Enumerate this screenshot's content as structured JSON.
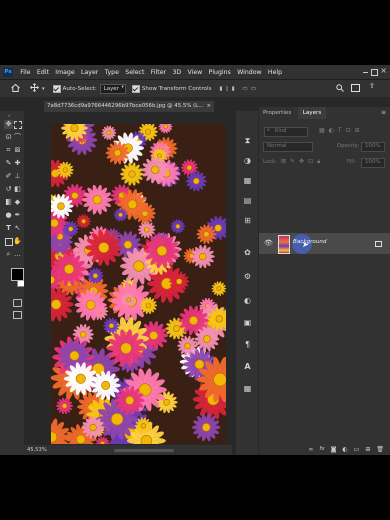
{
  "app": {
    "logo": "Ps"
  },
  "menu": [
    "File",
    "Edit",
    "Image",
    "Layer",
    "Type",
    "Select",
    "Filter",
    "3D",
    "View",
    "Plugins",
    "Window",
    "Help"
  ],
  "options": {
    "auto_select_label": "Auto-Select:",
    "auto_select_value": "Layer",
    "transform_label": "Show Transform Controls"
  },
  "document": {
    "tab_title": "7a8d7736cd9a9766446296b97bce056b.jpg @ 45.5% (L...",
    "zoom_status": "45.53%"
  },
  "panel": {
    "tabs": [
      "Properties",
      "Layers"
    ],
    "search_placeholder": "Kind",
    "blend_mode": "Normal",
    "opacity_label": "Opacity:",
    "opacity_value": "100%",
    "lock_label": "Lock:",
    "fill_label": "Fill:",
    "fill_value": "100%",
    "layer_name": "Background"
  },
  "colors": {
    "ui_bg": "#282828",
    "panel_bg": "#323232",
    "accent": "#31a8ff",
    "foreground_swatch": "#000000",
    "background_swatch": "#ffffff"
  },
  "icons": {
    "toolbar": [
      "move-icon",
      "marquee-icon",
      "lasso-icon",
      "quick-select-icon",
      "crop-icon",
      "frame-icon",
      "eyedropper-icon",
      "healing-icon",
      "brush-icon",
      "stamp-icon",
      "history-brush-icon",
      "eraser-icon",
      "gradient-icon",
      "blur-icon",
      "dodge-icon",
      "pen-icon",
      "type-icon",
      "path-select-icon",
      "shape-icon",
      "hand-icon",
      "zoom-icon"
    ],
    "dock": [
      "history-icon",
      "color-icon",
      "swatches-icon",
      "gradients-icon",
      "patterns-icon",
      "brushes-icon",
      "adjustments-icon",
      "styles-icon",
      "channels-icon",
      "paragraph-icon",
      "character-icon",
      "glyphs-icon"
    ],
    "layers_bottom": [
      "link-icon",
      "fx-icon",
      "mask-icon",
      "adjustment-icon",
      "group-icon",
      "new-layer-icon",
      "trash-icon"
    ]
  }
}
